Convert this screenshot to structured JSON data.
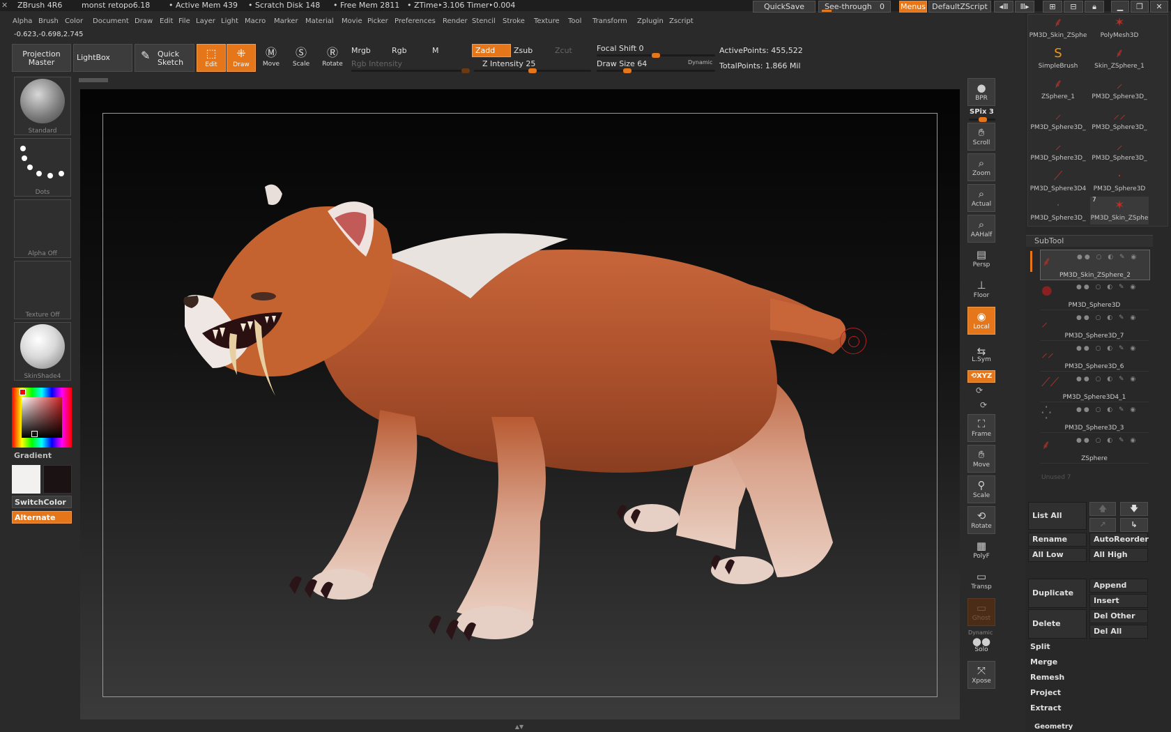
{
  "titlebar": {
    "app": "ZBrush 4R6",
    "document": "monst retopo6.18",
    "active_mem": "• Active Mem 439",
    "scratch_disk": "• Scratch Disk 148",
    "free_mem": "• Free Mem 2811",
    "ztime": "• ZTime‣3.106 Timer‣0.004",
    "quicksave": "QuickSave",
    "see_through": "See-through",
    "see_through_value": "0",
    "menus": "Menus",
    "default_zscript": "DefaultZScript"
  },
  "menubar": {
    "items": [
      "Alpha",
      "Brush",
      "Color",
      "Document",
      "Draw",
      "Edit",
      "File",
      "Layer",
      "Light",
      "Macro",
      "Marker",
      "Material",
      "Movie",
      "Picker",
      "Preferences",
      "Render",
      "Stencil",
      "Stroke",
      "Texture",
      "Tool",
      "Transform",
      "Zplugin",
      "Zscript"
    ]
  },
  "coords": "-0.623,-0.698,2.745",
  "toolbar": {
    "projection_master": "Projection Master",
    "lightbox": "LightBox",
    "quick_sketch": "Quick Sketch",
    "edit": "Edit",
    "draw": "Draw",
    "move": "Move",
    "scale": "Scale",
    "rotate": "Rotate",
    "mrgb": "Mrgb",
    "rgb": "Rgb",
    "m": "M",
    "zadd": "Zadd",
    "zsub": "Zsub",
    "zcut": "Zcut",
    "rgb_intensity": "Rgb Intensity",
    "z_intensity": "Z Intensity 25",
    "focal_shift": "Focal Shift 0",
    "draw_size": "Draw Size 64",
    "dynamic": "Dynamic",
    "active_points": "ActivePoints: 455,522",
    "total_points": "TotalPoints: 1.866 Mil"
  },
  "leftshelf": {
    "brush": "Standard",
    "stroke": "Dots",
    "alpha": "Alpha Off",
    "texture": "Texture Off",
    "material": "SkinShade4",
    "gradient": "Gradient",
    "switchcolor": "SwitchColor",
    "alternate": "Alternate"
  },
  "rightshelf": {
    "bpr": "BPR",
    "spix": "SPix 3",
    "scroll": "Scroll",
    "zoom": "Zoom",
    "actual": "Actual",
    "aahalf": "AAHalf",
    "persp": "Persp",
    "floor": "Floor",
    "local": "Local",
    "lsym": "L.Sym",
    "xyz": "⟲XYZ",
    "frame": "Frame",
    "move": "Move",
    "scale": "Scale",
    "rotate": "Rotate",
    "polyf": "PolyF",
    "transp": "Transp",
    "ghost": "Ghost",
    "dynamic": "Dynamic",
    "solo": "Solo",
    "xpose": "Xpose"
  },
  "toolpalette": {
    "meshes": [
      "PM3D_Skin_ZSphe",
      "PolyMesh3D",
      "SimpleBrush",
      "Skin_ZSphere_1",
      "ZSphere_1",
      "PM3D_Sphere3D_",
      "PM3D_Sphere3D_",
      "PM3D_Sphere3D_",
      "PM3D_Sphere3D_",
      "PM3D_Sphere3D_",
      "PM3D_Sphere3D4",
      "PM3D_Sphere3D",
      "PM3D_Sphere3D_",
      "PM3D_Skin_ZSphe"
    ],
    "badge": "7"
  },
  "subtool": {
    "title": "SubTool",
    "items": [
      "PM3D_Skin_ZSphere_2",
      "PM3D_Sphere3D",
      "PM3D_Sphere3D_7",
      "PM3D_Sphere3D_6",
      "PM3D_Sphere3D4_1",
      "PM3D_Sphere3D_3",
      "ZSphere"
    ],
    "unused": "Unused 7",
    "list_all": "List All",
    "rename": "Rename",
    "autoreorder": "AutoReorder",
    "all_low": "All Low",
    "all_high": "All High",
    "duplicate": "Duplicate",
    "append": "Append",
    "insert": "Insert",
    "delete": "Delete",
    "del_other": "Del Other",
    "del_all": "Del All",
    "split": "Split",
    "merge": "Merge",
    "remesh": "Remesh",
    "project": "Project",
    "extract": "Extract",
    "geometry": "Geometry"
  }
}
